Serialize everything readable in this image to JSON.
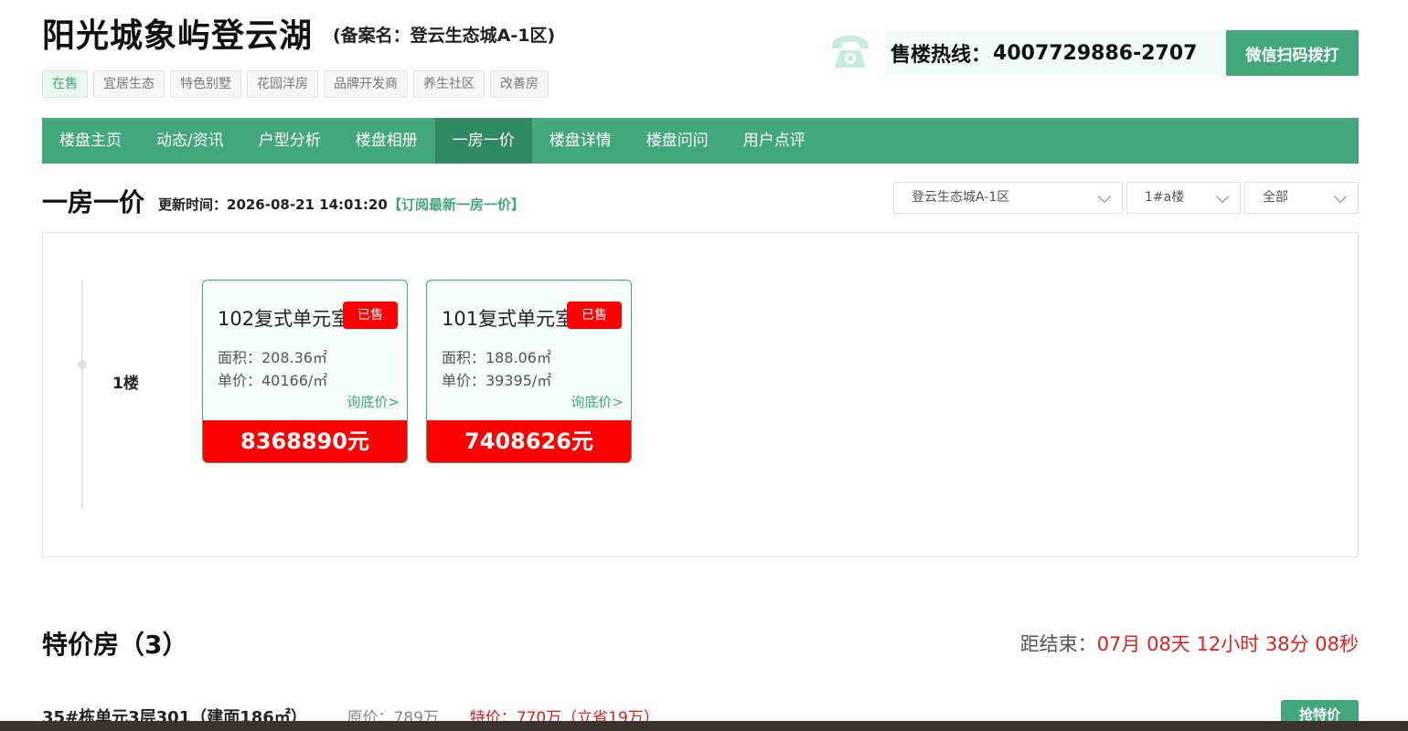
{
  "header": {
    "title": "阳光城象屿登云湖",
    "subtitle": "(备案名：登云生态城A-1区)",
    "tags": [
      "在售",
      "宜居生态",
      "特色别墅",
      "花园洋房",
      "品牌开发商",
      "养生社区",
      "改善房"
    ],
    "hotline_label": "售楼热线：",
    "hotline_number": "4007729886-2707",
    "wechat_button": "微信扫码拨打"
  },
  "nav": {
    "items": [
      "楼盘主页",
      "动态/资讯",
      "户型分析",
      "楼盘相册",
      "一房一价",
      "楼盘详情",
      "楼盘问问",
      "用户点评"
    ],
    "active": "一房一价"
  },
  "price_list": {
    "title": "一房一价",
    "update_time": "更新时间：2026-08-21 14:01:20",
    "subscribe": "【订阅最新一房一价】",
    "filters": {
      "phase": "登云生态城A-1区",
      "building": "1#a楼",
      "status": "全部"
    },
    "floor": "1楼",
    "units": [
      {
        "name": "102复式单元室",
        "status": "已售",
        "area": "面积：208.36㎡",
        "unit_price": "单价：40166/㎡",
        "ask": "询底价>",
        "total": "8368890元"
      },
      {
        "name": "101复式单元室",
        "status": "已售",
        "area": "面积：188.06㎡",
        "unit_price": "单价：39395/㎡",
        "ask": "询底价>",
        "total": "7408626元"
      }
    ]
  },
  "special": {
    "title": "特价房（3）",
    "countdown_label": "距结束：",
    "countdown_value": "07月 08天 12小时 38分 08秒",
    "offers": [
      {
        "name": "35#栋单元3层301（建面186㎡）",
        "original": "原价：789万",
        "special": "特价：770万（立省19万）",
        "button": "抢特价"
      }
    ]
  },
  "colors": {
    "brand": "#43a77c",
    "brand_dark": "#2f8a63",
    "sold": "#ff0000",
    "countdown": "#e02020"
  }
}
